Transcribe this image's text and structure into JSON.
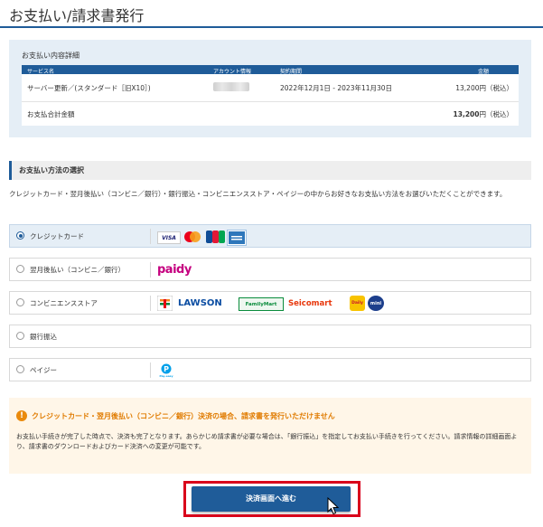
{
  "page": {
    "title": "お支払い/請求書発行"
  },
  "detail": {
    "heading": "お支払い内容詳細",
    "columns": [
      "サービス名",
      "アカウント情報",
      "契約期間",
      "金額"
    ],
    "row": {
      "service": "サーバー更新／(スタンダード［旧X10］)",
      "period": "2022年12月1日 - 2023年11月30日",
      "amount": "13,200円（税込）"
    },
    "total": {
      "label": "お支払合計金額",
      "amount": "13,200",
      "unit": "円（税込）"
    }
  },
  "methods": {
    "heading": "お支払い方法の選択",
    "description": "クレジットカード・翌月後払い（コンビニ／銀行）・銀行振込・コンビニエンスストア・ペイジーの中からお好きなお支払い方法をお選びいただくことができます。",
    "options": [
      {
        "label": "クレジットカード",
        "selected": true
      },
      {
        "label": "翌月後払い（コンビニ／銀行）",
        "selected": false
      },
      {
        "label": "コンビニエンスストア",
        "selected": false
      },
      {
        "label": "銀行振込",
        "selected": false
      },
      {
        "label": "ペイジー",
        "selected": false
      }
    ],
    "logos": {
      "visa": "VISA",
      "paidy": "paidy",
      "lawson": "LAWSON",
      "familymart": "FamilyMart",
      "seicomart": "Seicomart",
      "dailyyamazaki": "Daily",
      "ministop": "mini",
      "payeasy": "Pay-easy"
    }
  },
  "warning": {
    "icon": "!",
    "title": "クレジットカード・翌月後払い（コンビニ／銀行）決済の場合、請求書を発行いただけません",
    "body": "お支払い手続きが完了した時点で、決済も完了となります。あらかじめ請求書が必要な場合は、「銀行振込」を指定してお支払い手続きを行ってください。請求情報の詳細画面より、請求書のダウンロードおよびカード決済への変更が可能です。"
  },
  "submit": {
    "label": "決済画面へ進む"
  },
  "colors": {
    "brand": "#1f5c99",
    "warning": "#e07b00",
    "highlight": "#d9001b"
  }
}
